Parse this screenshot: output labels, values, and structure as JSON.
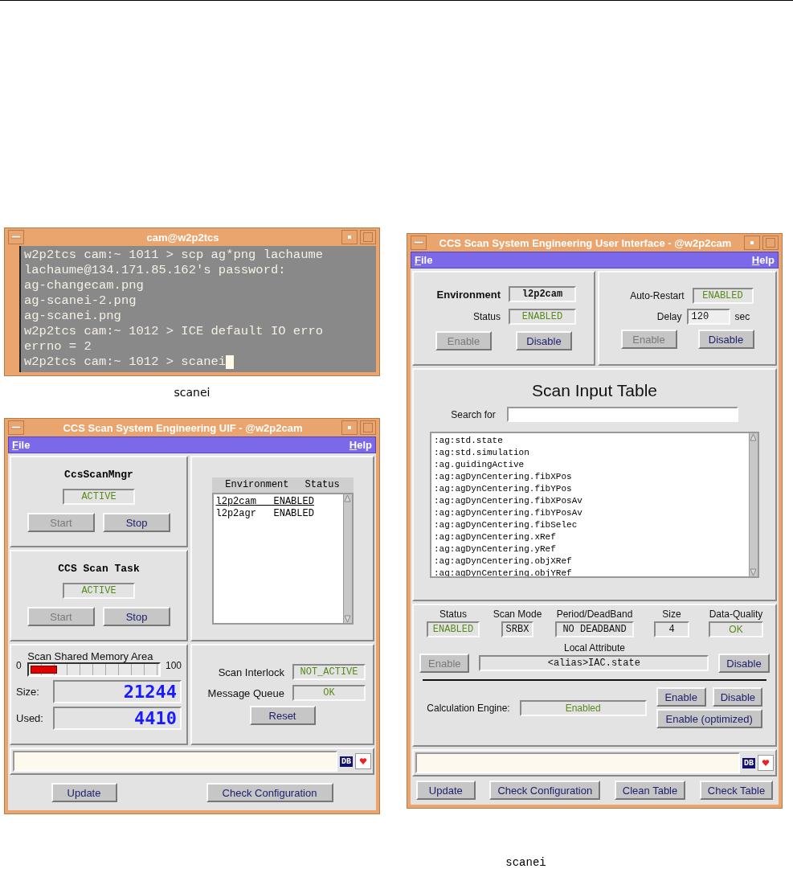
{
  "terminal": {
    "title": "cam@w2p2tcs",
    "lines": [
      "w2p2tcs cam:~ 1011 > scp ag*png lachaume",
      "lachaume@134.171.85.162's password:",
      "ag-changecam.png",
      "ag-scanei-2.png",
      "ag-scanei.png",
      "w2p2tcs cam:~ 1012 > ICE default IO erro",
      "errno = 2",
      "w2p2tcs cam:~ 1012 > scanei"
    ],
    "caption": "scanei"
  },
  "uif": {
    "title": "CCS Scan System Engineering UIF - @w2p2cam",
    "menu": [
      "File",
      "Help"
    ],
    "tasks": [
      {
        "name": "CcsScanMngr",
        "status": "ACTIVE",
        "buttons": [
          {
            "label": "Start",
            "disabled": true
          },
          {
            "label": "Stop",
            "disabled": false
          }
        ]
      },
      {
        "name": "CCS Scan Task",
        "status": "ACTIVE",
        "buttons": [
          {
            "label": "Start",
            "disabled": true
          },
          {
            "label": "Stop",
            "disabled": false
          }
        ]
      }
    ],
    "environments": {
      "columns": [
        "Environment",
        "Status"
      ],
      "rows": [
        {
          "environment": "l2p2cam",
          "status": "ENABLED",
          "selected": true
        },
        {
          "environment": "l2p2agr",
          "status": "ENABLED",
          "selected": false
        }
      ]
    },
    "memory": {
      "title": "Scan Shared Memory Area",
      "min": "0",
      "max": "100",
      "level": 0.2,
      "size_label": "Size:",
      "size": "21244",
      "used_label": "Used:",
      "used": "4410"
    },
    "interlock": {
      "fields": [
        {
          "label": "Scan Interlock",
          "value": "NOT_ACTIVE"
        },
        {
          "label": "Message Queue",
          "value": "OK"
        }
      ],
      "button": "Reset"
    },
    "status_badge": "DB",
    "buttons": [
      "Update",
      "Check Configuration"
    ]
  },
  "ui": {
    "title": "CCS Scan System Engineering User Interface - @w2p2cam",
    "menu": [
      "File",
      "Help"
    ],
    "environment": {
      "label": "Environment",
      "value": "l2p2cam",
      "status_label": "Status",
      "status": "ENABLED",
      "buttons": [
        {
          "label": "Enable",
          "disabled": true
        },
        {
          "label": "Disable",
          "disabled": false
        }
      ]
    },
    "restart": {
      "label": "Auto-Restart",
      "value": "ENABLED",
      "delay_label": "Delay",
      "delay": "120",
      "unit": "sec",
      "buttons": [
        {
          "label": "Enable",
          "disabled": true
        },
        {
          "label": "Disable",
          "disabled": false
        }
      ]
    },
    "table": {
      "title": "Scan Input Table",
      "search_label": "Search for",
      "items": [
        ":ag:std.state",
        ":ag:std.simulation",
        ":ag.guidingActive",
        ":ag:agDynCentering.fibXPos",
        ":ag:agDynCentering.fibYPos",
        ":ag:agDynCentering.fibXPosAv",
        ":ag:agDynCentering.fibYPosAv",
        ":ag:agDynCentering.fibSelec",
        ":ag:agDynCentering.xRef",
        ":ag:agDynCentering.yRef",
        ":ag:agDynCentering.objXRef",
        ":ag:agDynCentering.objYRef"
      ]
    },
    "attribute": {
      "columns": [
        {
          "label": "Status",
          "value": "ENABLED",
          "kind": "status"
        },
        {
          "label": "Scan Mode",
          "value": "SRBX",
          "kind": "plain"
        },
        {
          "label": "Period/DeadBand",
          "value": "NO DEADBAND",
          "kind": "plain"
        },
        {
          "label": "Size",
          "value": "4",
          "kind": "plain"
        },
        {
          "label": "Data-Quality",
          "value": "OK",
          "kind": "status"
        }
      ],
      "local_label": "Local Attribute",
      "local_value": "<alias>IAC.state",
      "buttons": [
        {
          "label": "Enable",
          "disabled": true
        },
        {
          "label": "Disable",
          "disabled": false
        }
      ]
    },
    "engine": {
      "label": "Calculation Engine:",
      "value": "Enabled",
      "buttons": [
        {
          "label": "Enable",
          "disabled": false
        },
        {
          "label": "Disable",
          "disabled": false
        },
        {
          "label": "Enable (optimized)",
          "disabled": false
        }
      ]
    },
    "status_badge": "DB",
    "buttons": [
      "Update",
      "Check Configuration",
      "Clean Table",
      "Check Table"
    ]
  },
  "figure_caption": "scanei"
}
